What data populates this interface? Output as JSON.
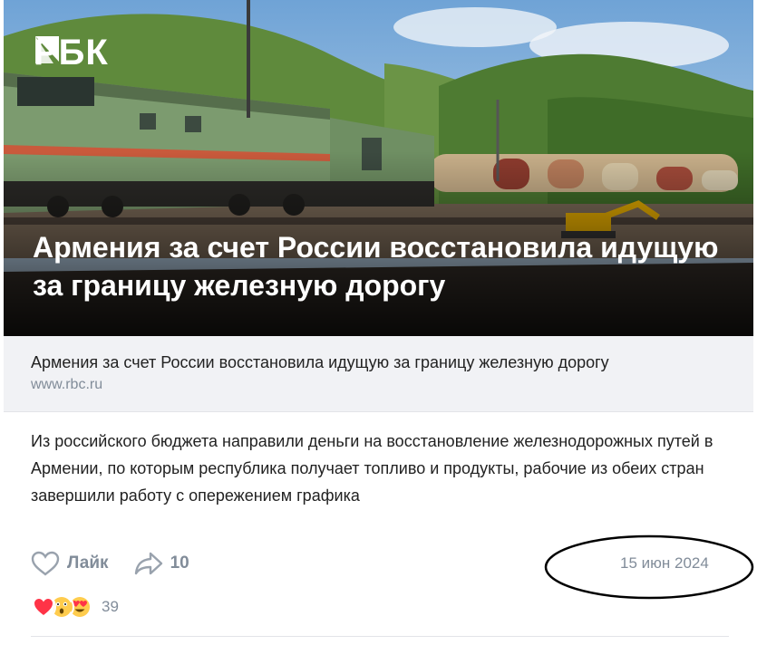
{
  "brand": {
    "logo_text": "РБК"
  },
  "hero": {
    "title": "Армения за счет России восстановила идущую за границу железную дорогу"
  },
  "link": {
    "title": "Армения за счет России восстановила идущую за границу железную дорогу",
    "domain": "www.rbc.ru"
  },
  "post": {
    "text": "Из российского бюджета направили деньги на восстановление железнодорожных путей в Армении, по которым республика получает топливо и продукты, рабочие из обеих стран завершили работу с опережением графика"
  },
  "actions": {
    "like_label": "Лайк",
    "share_count": "10",
    "like_icon": "heart-outline-icon",
    "share_icon": "share-arrow-icon"
  },
  "date": "15 июн 2024",
  "reactions": {
    "emojis": [
      "heart-emoji",
      "astonished-emoji",
      "heart-eyes-emoji"
    ],
    "count": "39"
  },
  "colors": {
    "muted": "#818c99",
    "text": "#222222",
    "link_bg": "#f1f2f5",
    "annotation": "#000000"
  }
}
